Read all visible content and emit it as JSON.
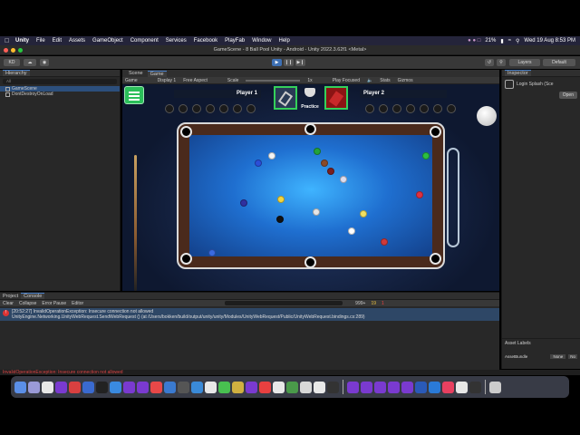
{
  "menubar": {
    "app": "Unity",
    "items": [
      "File",
      "Edit",
      "Assets",
      "GameObject",
      "Component",
      "Services",
      "Facebook",
      "PlayFab",
      "Window",
      "Help"
    ],
    "battery": "21%",
    "datetime": "Wed 19 Aug  8:53 PM"
  },
  "window": {
    "title": "GameScene - 8 Ball Pool Unity - Android - Unity 2022.3.62f1 <Metal>"
  },
  "toolbar": {
    "account": "KD",
    "layers_label": "Layers",
    "layout_label": "Default"
  },
  "hierarchy": {
    "tab": "Hierarchy",
    "search_placeholder": "All",
    "items": [
      "GameScene",
      "DontDestroyOnLoad"
    ]
  },
  "game_panel": {
    "tabs": [
      "Scene",
      "Game"
    ],
    "mode": "Game",
    "display": "Display 1",
    "aspect": "Free Aspect",
    "scale_label": "Scale",
    "scale_value": "1x",
    "play_focused": "Play Focused",
    "stats": "Stats",
    "gizmos": "Gizmos"
  },
  "game": {
    "player1": "Player 1",
    "player2": "Player 2",
    "practice": "Practice"
  },
  "inspector": {
    "tab": "Inspector",
    "object": "Login Splash (Sce",
    "open_button": "Open",
    "asset_labels": "Asset Labels",
    "asset_bundle_label": "AssetBundle",
    "asset_bundle_value": "None",
    "asset_variant_value": "No"
  },
  "console": {
    "tabs": [
      "Project",
      "Console"
    ],
    "buttons": [
      "Clear",
      "Collapse",
      "Error Pause",
      "Editor"
    ],
    "counts": {
      "log": "999+",
      "warn": "19",
      "error": "1"
    },
    "log_line1": "[20:52:27] InvalidOperationException: Insecure connection not allowed",
    "log_line2": "UnityEngine.Networking.UnityWebRequest.SendWebRequest () (at /Users/bokken/build/output/unity/unity/Modules/UnityWebRequest/Public/UnityWebRequest.bindings.cs:289)"
  },
  "status": {
    "text": "InvalidOperationException: Insecure connection not allowed"
  },
  "colors": {
    "accent": "#3d6fb3",
    "error": "#dd3333",
    "felt": "#2a8ae8"
  }
}
